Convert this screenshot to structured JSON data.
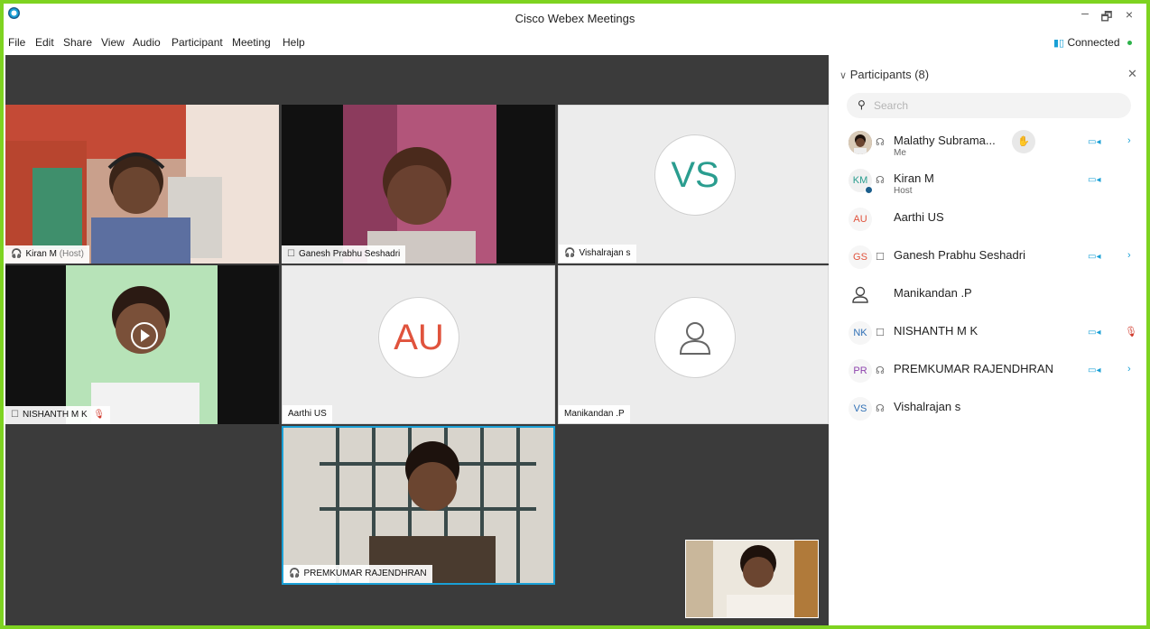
{
  "window": {
    "title": "Cisco Webex Meetings",
    "controls": {
      "minimize": "–",
      "restore": "🗗",
      "close": "×"
    }
  },
  "menu": [
    "File",
    "Edit",
    "Share",
    "View",
    "Audio",
    "Participant",
    "Meeting",
    "Help"
  ],
  "status": {
    "connection": "Connected",
    "connection_color": "#2db24a"
  },
  "stage": {
    "tiles": [
      {
        "name": "Kiran M",
        "suffix": "(Host)",
        "type": "video",
        "audio_icon": "headset-icon"
      },
      {
        "name": "Ganesh Prabhu Seshadri",
        "type": "video",
        "audio_icon": "phone-icon"
      },
      {
        "name": "Vishalrajan s",
        "type": "avatar",
        "initials": "VS",
        "initials_color": "#2a9d8f",
        "audio_icon": "headset-icon"
      },
      {
        "name": "NISHANTH M K",
        "type": "video",
        "audio_icon": "phone-icon",
        "muted": true
      },
      {
        "name": "Aarthi US",
        "type": "avatar",
        "initials": "AU",
        "initials_color": "#e0533d"
      },
      {
        "name": "Manikandan .P",
        "type": "avatar",
        "initials": "",
        "icon": "person-icon"
      },
      {
        "name": "PREMKUMAR RAJENDHRAN",
        "type": "video",
        "audio_icon": "headset-icon",
        "active_speaker": true
      }
    ]
  },
  "participants": {
    "header": "Participants (8)",
    "search_placeholder": "Search",
    "list": [
      {
        "name": "Malathy Subrama...",
        "sub": "Me",
        "avatar": "photo",
        "audio": "headset-icon",
        "video": true,
        "raise_hand": true,
        "more": true
      },
      {
        "name": "Kiran M",
        "sub": "Host",
        "initials": "KM",
        "initials_color": "#2a9d8f",
        "audio": "headset-icon",
        "video": true
      },
      {
        "name": "Aarthi US",
        "initials": "AU",
        "initials_color": "#e0533d"
      },
      {
        "name": "Ganesh Prabhu Seshadri",
        "initials": "GS",
        "initials_color": "#e0533d",
        "audio": "phone-icon",
        "video": true,
        "more": true
      },
      {
        "name": "Manikandan .P",
        "initials": "",
        "avatar": "person-icon"
      },
      {
        "name": "NISHANTH M K",
        "initials": "NK",
        "initials_color": "#2f6fb5",
        "audio": "phone-icon",
        "video": true,
        "muted": true
      },
      {
        "name": "PREMKUMAR RAJENDHRAN",
        "initials": "PR",
        "initials_color": "#8e44ad",
        "audio": "headset-icon",
        "video": true,
        "more": true
      },
      {
        "name": "Vishalrajan s",
        "initials": "VS",
        "initials_color": "#2f6fb5",
        "audio": "headset-icon"
      }
    ]
  }
}
